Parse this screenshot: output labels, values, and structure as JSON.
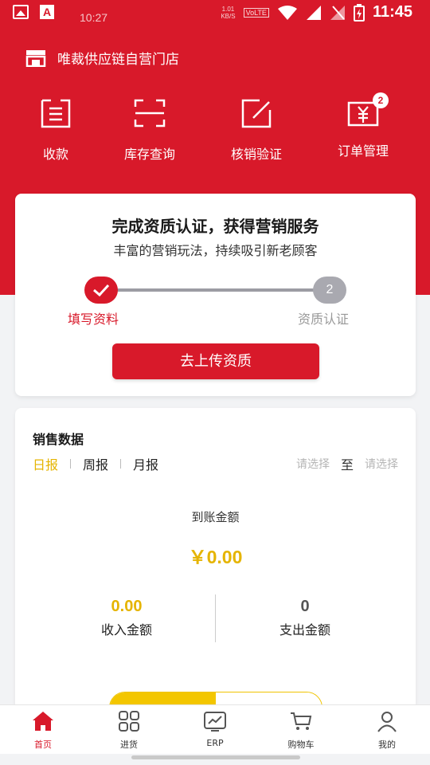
{
  "status_bar": {
    "time_small": "10:27",
    "net_speed": "1.01",
    "net_unit": "KB/S",
    "volte": "VoLTE",
    "time": "11:45"
  },
  "store": {
    "name": "唯裁供应链自营门店",
    "icon": "store-icon"
  },
  "quick_actions": [
    {
      "label": "收款",
      "icon": "receipt-icon"
    },
    {
      "label": "库存查询",
      "icon": "scan-icon"
    },
    {
      "label": "核销验证",
      "icon": "edit-icon"
    },
    {
      "label": "订单管理",
      "icon": "order-icon",
      "badge": "2"
    }
  ],
  "cert_card": {
    "title": "完成资质认证，获得营销服务",
    "subtitle": "丰富的营销玩法，持续吸引新老顾客",
    "step1_label": "填写资料",
    "step2_number": "2",
    "step2_label": "资质认证",
    "button_label": "去上传资质"
  },
  "sales": {
    "title": "销售数据",
    "tabs": [
      "日报",
      "周报",
      "月报"
    ],
    "active_tab": "日报",
    "date_start_placeholder": "请选择",
    "date_to": "至",
    "date_end_placeholder": "请选择",
    "arrival_label": "到账金额",
    "arrival_value": "￥0.00",
    "income_value": "0.00",
    "income_label": "收入金额",
    "expense_value": "0",
    "expense_label": "支出金额"
  },
  "bottom_nav": [
    {
      "label": "首页",
      "icon": "home-icon",
      "active": true
    },
    {
      "label": "进货",
      "icon": "grid-icon"
    },
    {
      "label": "ERP",
      "icon": "erp-icon"
    },
    {
      "label": "购物车",
      "icon": "cart-icon"
    },
    {
      "label": "我的",
      "icon": "profile-icon"
    }
  ],
  "colors": {
    "brand_red": "#d8192a",
    "accent_yellow": "#e5b400"
  }
}
